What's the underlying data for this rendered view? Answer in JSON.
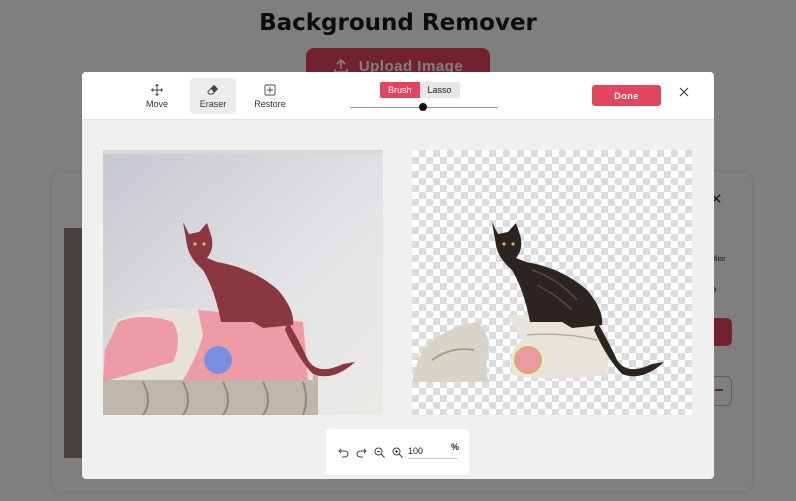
{
  "background_page": {
    "title": "Background Remover",
    "upload_label": "Upload Image",
    "side_label": "ditor"
  },
  "modal": {
    "tools": [
      {
        "label": "Move",
        "icon": "move-icon"
      },
      {
        "label": "Eraser",
        "icon": "eraser-icon",
        "active": true
      },
      {
        "label": "Restore",
        "icon": "restore-icon"
      }
    ],
    "mode_toggle": {
      "options": [
        "Brush",
        "Lasso"
      ],
      "selected": "Brush"
    },
    "brush_size_fraction": 0.5,
    "done_label": "Done",
    "zoom": {
      "value": "100",
      "unit": "%"
    }
  },
  "colors": {
    "accent": "#e0475f",
    "mask_pink": "#f08a9c",
    "brush_cursor": "#6b8fe8"
  }
}
